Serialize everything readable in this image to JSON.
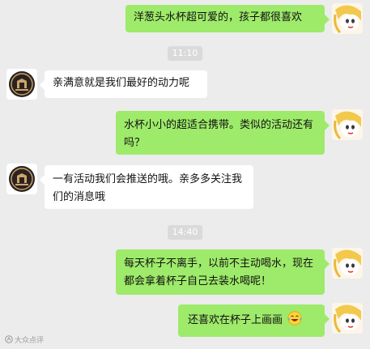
{
  "messages": [
    {
      "text": "洋葱头水杯超可爱的，孩子都很喜欢"
    },
    {
      "text": "亲满意就是我们最好的动力呢"
    },
    {
      "text": "水杯小小的超适合携带。类似的活动还有吗？"
    },
    {
      "text": "一有活动我们会推送的哦。亲多多关注我们的消息哦"
    },
    {
      "text": "每天杯子不离手，以前不主动喝水，现在都会拿着杯子自己去装水喝呢！"
    },
    {
      "text": "还喜欢在杯子上画画",
      "emoji": "laughing-tears-emoji"
    }
  ],
  "timestamps": [
    "11:10",
    "14:40"
  ],
  "icons": {
    "self_avatar": "cartoon-girl-avatar",
    "shop_avatar": "shop-badge-avatar"
  },
  "colors": {
    "background": "#ececec",
    "outgoing_bubble": "#9eea6a",
    "incoming_bubble": "#ffffff",
    "timestamp_bg": "#dadada"
  },
  "watermark": {
    "text": "大众点评"
  }
}
